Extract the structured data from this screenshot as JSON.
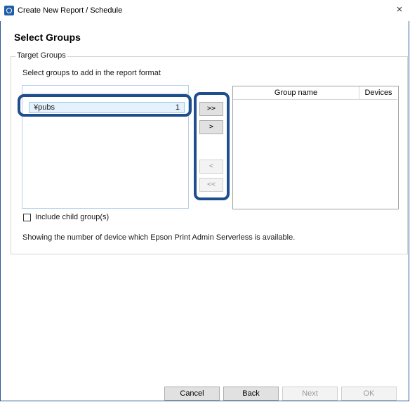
{
  "window": {
    "title": "Create New Report / Schedule",
    "close_glyph": "×"
  },
  "page": {
    "heading": "Select Groups"
  },
  "target_groups": {
    "legend": "Target Groups",
    "instruction": "Select groups to add in the report format",
    "available_groups": [
      {
        "name": "¥pubs",
        "count": "1"
      }
    ],
    "buttons": {
      "add_all": ">>",
      "add": ">",
      "remove": "<",
      "remove_all": "<<"
    },
    "selected_table": {
      "columns": [
        "Group name",
        "Devices"
      ],
      "rows": []
    },
    "include_child_label": "Include child group(s)",
    "include_child_checked": false,
    "info_text": "Showing the number of device which Epson Print Admin Serverless is available."
  },
  "footer": {
    "cancel": "Cancel",
    "back": "Back",
    "next": "Next",
    "ok": "OK"
  },
  "colors": {
    "highlight": "#1f4e8c",
    "selection": "#e5f1fb"
  },
  "icons": {
    "app": "app-icon",
    "close": "close-icon"
  }
}
